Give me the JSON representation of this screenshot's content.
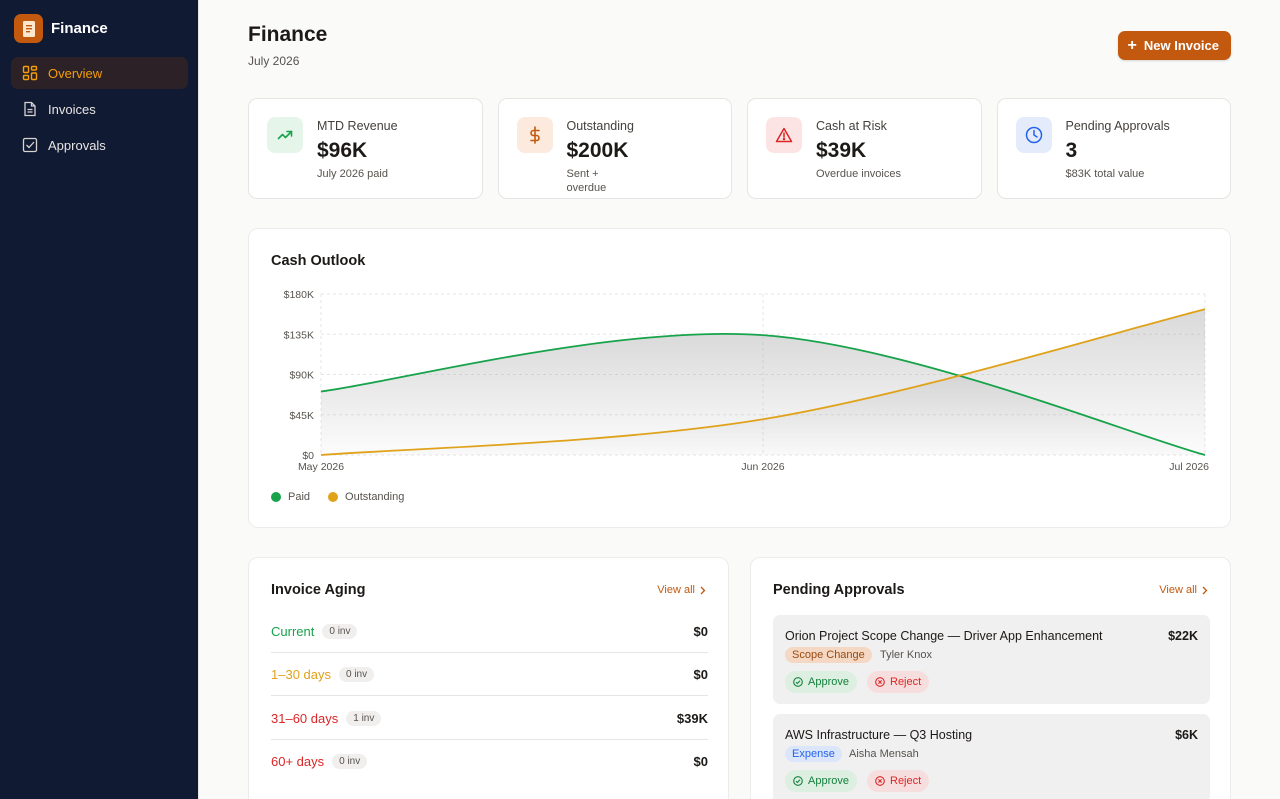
{
  "brand": {
    "name": "Finance",
    "accent": "#c2590f"
  },
  "sidebar": {
    "items": [
      {
        "label": "Overview",
        "icon": "grid-icon",
        "active": true
      },
      {
        "label": "Invoices",
        "icon": "document-icon",
        "active": false
      },
      {
        "label": "Approvals",
        "icon": "checkbox-icon",
        "active": false
      }
    ]
  },
  "header": {
    "title": "Finance",
    "subtitle": "July 2026",
    "new_button": "New Invoice"
  },
  "kpis": [
    {
      "label": "MTD Revenue",
      "value": "$96K",
      "note": "July 2026 paid",
      "icon": "trend-up-icon",
      "color": "#16a34a"
    },
    {
      "label": "Outstanding",
      "value": "$200K",
      "note": "Sent + overdue",
      "icon": "dollar-icon",
      "color": "#c2590f"
    },
    {
      "label": "Cash at Risk",
      "value": "$39K",
      "note": "Overdue invoices",
      "icon": "alert-icon",
      "color": "#dc2626"
    },
    {
      "label": "Pending Approvals",
      "value": "3",
      "note": "$83K total value",
      "icon": "clock-icon",
      "color": "#2563eb"
    }
  ],
  "chart_card": {
    "title": "Cash Outlook"
  },
  "chart_data": {
    "type": "area",
    "title": "Cash Outlook",
    "x": [
      "May 2026",
      "Jun 2026",
      "Jul 2026"
    ],
    "ylim": [
      0,
      180000
    ],
    "yticks": [
      "$0",
      "$45K",
      "$90K",
      "$135K",
      "$180K"
    ],
    "grid": true,
    "legend": "bottom-left",
    "series": [
      {
        "name": "Paid",
        "color": "#16a34a",
        "values": [
          71000,
          134000,
          0
        ]
      },
      {
        "name": "Outstanding",
        "color": "#e0a21a",
        "values": [
          0,
          40000,
          163000
        ]
      }
    ]
  },
  "aging": {
    "title": "Invoice Aging",
    "view_all": "View all",
    "rows": [
      {
        "label": "Current",
        "count": "0 inv",
        "value": "$0",
        "color": "#16a34a"
      },
      {
        "label": "1–30 days",
        "count": "0 inv",
        "value": "$0",
        "color": "#e0a21a"
      },
      {
        "label": "31–60 days",
        "count": "1 inv",
        "value": "$39K",
        "color": "#dc2626"
      },
      {
        "label": "60+ days",
        "count": "0 inv",
        "value": "$0",
        "color": "#dc2626"
      }
    ]
  },
  "approvals": {
    "title": "Pending Approvals",
    "view_all": "View all",
    "approve_label": "Approve",
    "reject_label": "Reject",
    "items": [
      {
        "name": "Orion Project Scope Change — Driver App Enhancement",
        "amount": "$22K",
        "tag": "Scope Change",
        "person": "Tyler Knox"
      },
      {
        "name": "AWS Infrastructure — Q3 Hosting",
        "amount": "$6K",
        "tag": "Expense",
        "person": "Aisha Mensah"
      }
    ]
  }
}
